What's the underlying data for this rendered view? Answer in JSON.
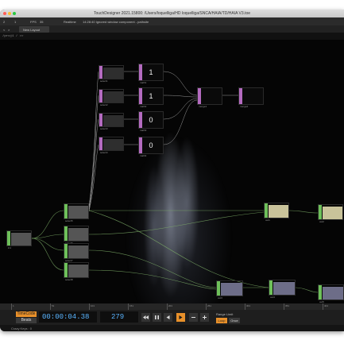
{
  "window": {
    "title": "TouchDesigner 2021.15800: /Users/loquelliga/HD loquelliga/SNCA/HAIA/TD/HAIA V3.toe"
  },
  "menubar": {
    "items": [
      "2",
      "1",
      "FPS",
      "35",
      "Realtime",
      "14:28:40 Ignored window component - pathsite"
    ]
  },
  "pathbar": {
    "nav_items": [
      "<",
      ">"
    ],
    "tab_label": "New Layout"
  },
  "address": {
    "path": "/proj1 / >>"
  },
  "network": {
    "values": {
      "v1": "1",
      "v2": "1",
      "v3": "0",
      "v4": "0"
    },
    "labels": {
      "sel1": "select1",
      "sel2": "select2",
      "sel3": "select3",
      "sel4": "select4",
      "math1": "math1",
      "math2": "math2",
      "math3": "math3",
      "math4": "math4",
      "merge1": "merge1",
      "merge2": "merge2",
      "in1": "in1",
      "null1": "null1",
      "sel5": "select5",
      "sel6": "select6",
      "sel7": "select7",
      "sel8": "select8",
      "out1": "out1",
      "out2": "out2",
      "out3": "out3",
      "out4": "out4",
      "out5": "out5"
    }
  },
  "timeline": {
    "ticks": [
      "1",
      "51",
      "101",
      "151",
      "201",
      "251",
      "301",
      "351",
      "401"
    ]
  },
  "transport": {
    "timecode_label": "TimeCode",
    "beats_label": "Beats",
    "timecode": "00:00:04.38",
    "frame": "279",
    "range_limit_label": "Range Limit",
    "loop_label": "Loop",
    "once_label": "Once"
  },
  "status": {
    "text": "Crazy Keys : 0"
  },
  "colors": {
    "accent": "#e8902a",
    "chop": "#b46bc0",
    "top": "#7a4f9a",
    "sop": "#6ec05a",
    "timecode": "#5ab4ff"
  }
}
